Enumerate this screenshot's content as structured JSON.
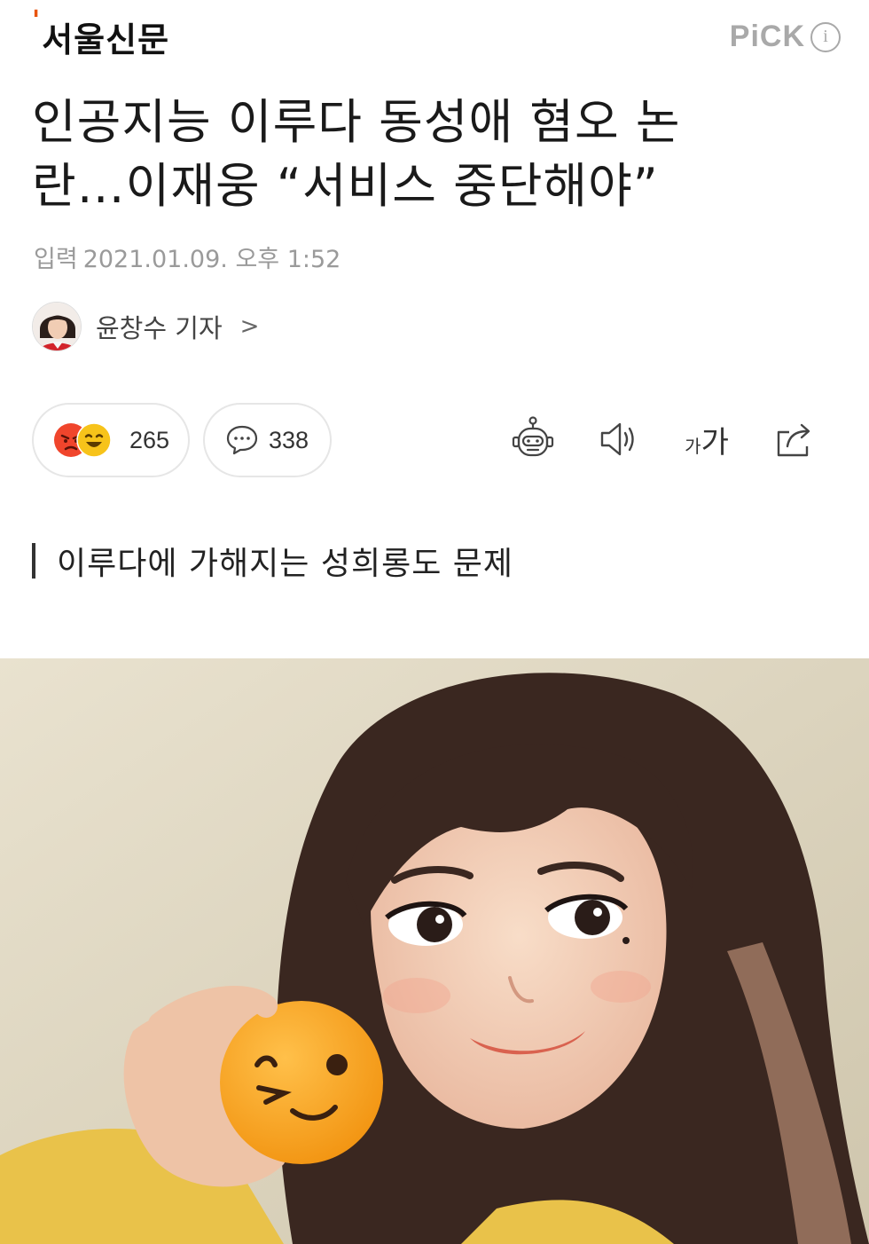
{
  "header": {
    "logo_mark": "'",
    "logo_text": "서울신문",
    "pick_label": "PiCK",
    "pick_info": "i"
  },
  "article": {
    "headline_line1": "인공지능 이루다 동성애 혐오 논",
    "headline_line2": "란…이재웅 “서비스 중단해야”",
    "date_label": "입력",
    "date_value": "2021.01.09. 오후 1:52",
    "reporter_name": "윤창수 기자",
    "reporter_arrow": ">",
    "subheading": "이루다에 가해지는 성희롱도 문제"
  },
  "actions": {
    "reaction_count": "265",
    "comment_count": "338",
    "font_small": "가",
    "font_large": "가"
  },
  "colors": {
    "brand_orange": "#e8540f",
    "angry_red": "#f0452c",
    "smile_yellow": "#f7c31a",
    "muted_gray": "#9a9a9a",
    "pill_border": "#e6e6e6"
  },
  "icons": {
    "reactions": [
      "angry-face-icon",
      "laughing-face-icon"
    ],
    "comment": "speech-bubble-icon",
    "tools": [
      "robot-summary-icon",
      "speaker-icon",
      "font-size-icon",
      "share-icon"
    ]
  }
}
